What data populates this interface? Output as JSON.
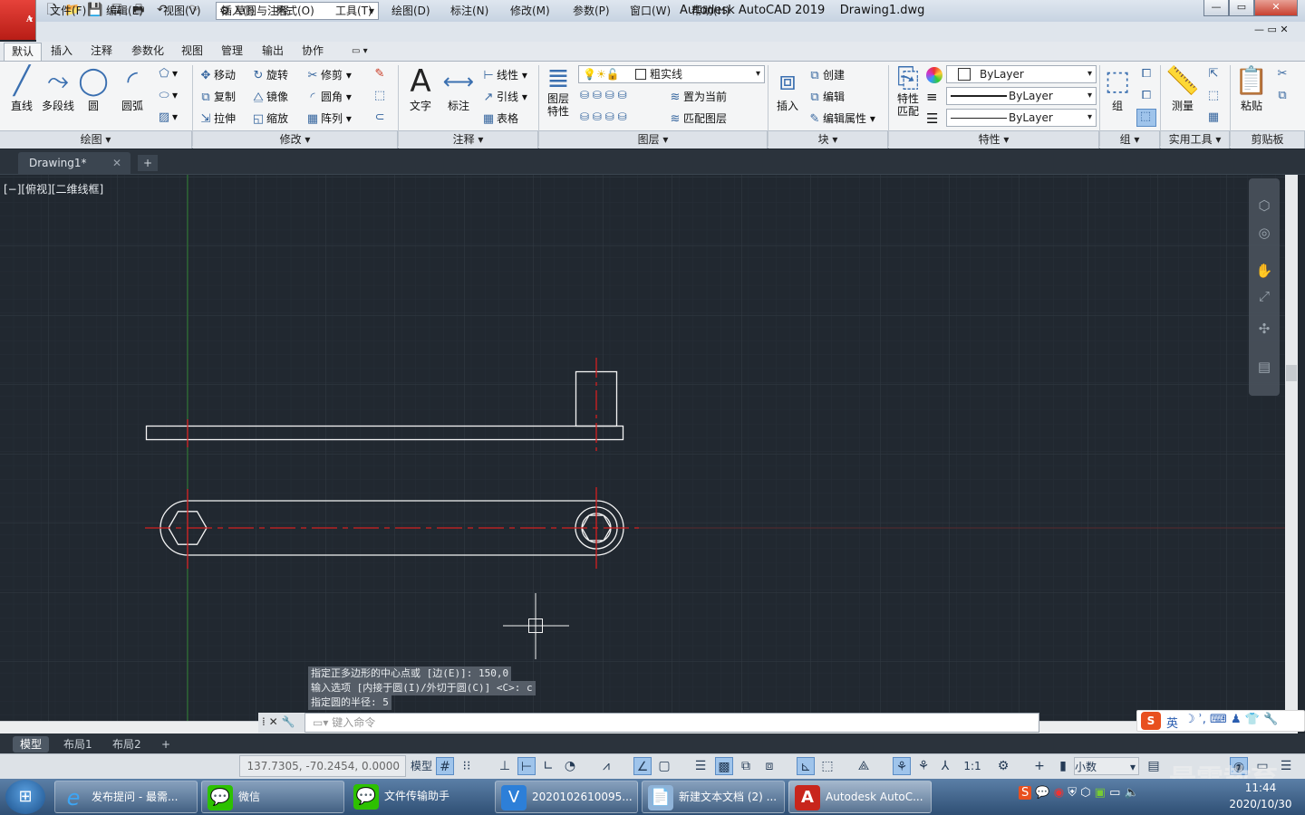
{
  "app": {
    "name": "Autodesk AutoCAD 2019",
    "file": "Drawing1.dwg",
    "logo_letter": "A",
    "workspace": "草图与注释"
  },
  "window_controls": {
    "minimize": "—",
    "restore": "▭",
    "close": "✕"
  },
  "menubar": [
    "文件(F)",
    "编辑(E)",
    "视图(V)",
    "插入(I)",
    "格式(O)",
    "工具(T)",
    "绘图(D)",
    "标注(N)",
    "修改(M)",
    "参数(P)",
    "窗口(W)",
    "帮助(H)"
  ],
  "ribbon_tabs": [
    "默认",
    "插入",
    "注释",
    "参数化",
    "视图",
    "管理",
    "输出",
    "协作"
  ],
  "ribbon": {
    "draw": {
      "line": "直线",
      "polyline": "多段线",
      "circle": "圆",
      "arc": "圆弧",
      "panel": "绘图 ▾"
    },
    "modify": {
      "move": "移动",
      "rotate": "旋转",
      "trim": "修剪",
      "copy": "复制",
      "mirror": "镜像",
      "fillet": "圆角",
      "stretch": "拉伸",
      "scale": "缩放",
      "array": "阵列",
      "panel": "修改 ▾"
    },
    "annotation": {
      "text": "文字",
      "dim": "标注",
      "linear": "线性",
      "leader": "引线",
      "table": "表格",
      "panel": "注释 ▾"
    },
    "layers": {
      "layer_props": "图层\n特性",
      "current_layer": "粗实线",
      "set_current": "置为当前",
      "match_layer": "匹配图层",
      "panel": "图层 ▾"
    },
    "block": {
      "insert": "插入",
      "create": "创建",
      "edit": "编辑",
      "edit_attr": "编辑属性",
      "panel": "块 ▾"
    },
    "properties": {
      "match": "特性\n匹配",
      "color": "ByLayer",
      "linetype": "ByLayer",
      "lineweight": "ByLayer",
      "panel": "特性 ▾"
    },
    "groups": {
      "group": "组",
      "panel": "组 ▾"
    },
    "utilities": {
      "measure": "测量",
      "panel": "实用工具 ▾"
    },
    "clipboard": {
      "paste": "粘贴",
      "panel": "剪贴板"
    }
  },
  "document_tab": "Drawing1*",
  "viewport_label": "[−][俯视][二维线框]",
  "command_history": [
    "指定正多边形的中心点或 [边(E)]: 150,0",
    "输入选项 [内接于圆(I)/外切于圆(C)] <C>: c",
    "指定圆的半径: 5"
  ],
  "command_placeholder": "键入命令",
  "layout_tabs": [
    "模型",
    "布局1",
    "布局2"
  ],
  "status": {
    "coords": "137.7305, -70.2454, 0.0000",
    "model": "模型",
    "scale": "1:1",
    "units": "小数"
  },
  "taskbar": {
    "items": [
      "发布提问 - 最需...",
      "微信",
      "文件传输助手",
      "2020102610095...",
      "新建文本文档 (2) ...",
      "Autodesk AutoC..."
    ],
    "clock_time": "11:44",
    "clock_date": "2020/10/30"
  },
  "ime": {
    "lang": "英"
  },
  "watermark": "最需教育",
  "colors": {
    "canvas": "#212830",
    "geometry": "#ffffff",
    "centerline": "#d42020",
    "ucs_y": "#2b7d2b"
  }
}
